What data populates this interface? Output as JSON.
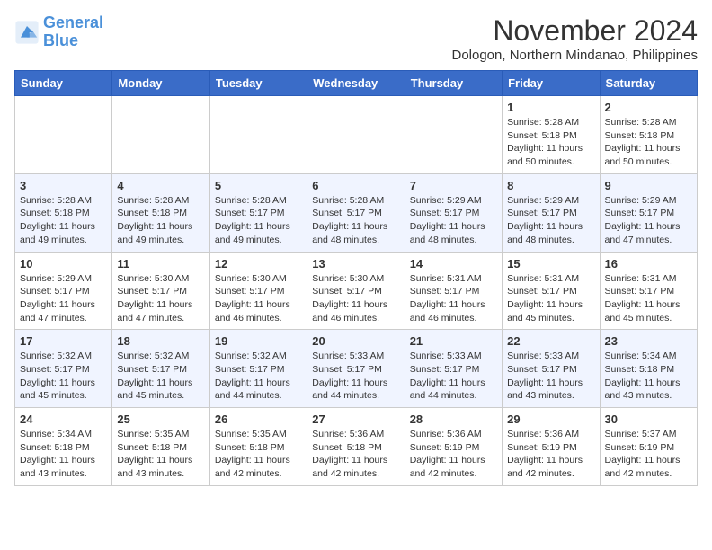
{
  "header": {
    "logo_line1": "General",
    "logo_line2": "Blue",
    "month_title": "November 2024",
    "location": "Dologon, Northern Mindanao, Philippines"
  },
  "weekdays": [
    "Sunday",
    "Monday",
    "Tuesday",
    "Wednesday",
    "Thursday",
    "Friday",
    "Saturday"
  ],
  "weeks": [
    [
      {
        "day": "",
        "info": ""
      },
      {
        "day": "",
        "info": ""
      },
      {
        "day": "",
        "info": ""
      },
      {
        "day": "",
        "info": ""
      },
      {
        "day": "",
        "info": ""
      },
      {
        "day": "1",
        "info": "Sunrise: 5:28 AM\nSunset: 5:18 PM\nDaylight: 11 hours and 50 minutes."
      },
      {
        "day": "2",
        "info": "Sunrise: 5:28 AM\nSunset: 5:18 PM\nDaylight: 11 hours and 50 minutes."
      }
    ],
    [
      {
        "day": "3",
        "info": "Sunrise: 5:28 AM\nSunset: 5:18 PM\nDaylight: 11 hours and 49 minutes."
      },
      {
        "day": "4",
        "info": "Sunrise: 5:28 AM\nSunset: 5:18 PM\nDaylight: 11 hours and 49 minutes."
      },
      {
        "day": "5",
        "info": "Sunrise: 5:28 AM\nSunset: 5:17 PM\nDaylight: 11 hours and 49 minutes."
      },
      {
        "day": "6",
        "info": "Sunrise: 5:28 AM\nSunset: 5:17 PM\nDaylight: 11 hours and 48 minutes."
      },
      {
        "day": "7",
        "info": "Sunrise: 5:29 AM\nSunset: 5:17 PM\nDaylight: 11 hours and 48 minutes."
      },
      {
        "day": "8",
        "info": "Sunrise: 5:29 AM\nSunset: 5:17 PM\nDaylight: 11 hours and 48 minutes."
      },
      {
        "day": "9",
        "info": "Sunrise: 5:29 AM\nSunset: 5:17 PM\nDaylight: 11 hours and 47 minutes."
      }
    ],
    [
      {
        "day": "10",
        "info": "Sunrise: 5:29 AM\nSunset: 5:17 PM\nDaylight: 11 hours and 47 minutes."
      },
      {
        "day": "11",
        "info": "Sunrise: 5:30 AM\nSunset: 5:17 PM\nDaylight: 11 hours and 47 minutes."
      },
      {
        "day": "12",
        "info": "Sunrise: 5:30 AM\nSunset: 5:17 PM\nDaylight: 11 hours and 46 minutes."
      },
      {
        "day": "13",
        "info": "Sunrise: 5:30 AM\nSunset: 5:17 PM\nDaylight: 11 hours and 46 minutes."
      },
      {
        "day": "14",
        "info": "Sunrise: 5:31 AM\nSunset: 5:17 PM\nDaylight: 11 hours and 46 minutes."
      },
      {
        "day": "15",
        "info": "Sunrise: 5:31 AM\nSunset: 5:17 PM\nDaylight: 11 hours and 45 minutes."
      },
      {
        "day": "16",
        "info": "Sunrise: 5:31 AM\nSunset: 5:17 PM\nDaylight: 11 hours and 45 minutes."
      }
    ],
    [
      {
        "day": "17",
        "info": "Sunrise: 5:32 AM\nSunset: 5:17 PM\nDaylight: 11 hours and 45 minutes."
      },
      {
        "day": "18",
        "info": "Sunrise: 5:32 AM\nSunset: 5:17 PM\nDaylight: 11 hours and 45 minutes."
      },
      {
        "day": "19",
        "info": "Sunrise: 5:32 AM\nSunset: 5:17 PM\nDaylight: 11 hours and 44 minutes."
      },
      {
        "day": "20",
        "info": "Sunrise: 5:33 AM\nSunset: 5:17 PM\nDaylight: 11 hours and 44 minutes."
      },
      {
        "day": "21",
        "info": "Sunrise: 5:33 AM\nSunset: 5:17 PM\nDaylight: 11 hours and 44 minutes."
      },
      {
        "day": "22",
        "info": "Sunrise: 5:33 AM\nSunset: 5:17 PM\nDaylight: 11 hours and 43 minutes."
      },
      {
        "day": "23",
        "info": "Sunrise: 5:34 AM\nSunset: 5:18 PM\nDaylight: 11 hours and 43 minutes."
      }
    ],
    [
      {
        "day": "24",
        "info": "Sunrise: 5:34 AM\nSunset: 5:18 PM\nDaylight: 11 hours and 43 minutes."
      },
      {
        "day": "25",
        "info": "Sunrise: 5:35 AM\nSunset: 5:18 PM\nDaylight: 11 hours and 43 minutes."
      },
      {
        "day": "26",
        "info": "Sunrise: 5:35 AM\nSunset: 5:18 PM\nDaylight: 11 hours and 42 minutes."
      },
      {
        "day": "27",
        "info": "Sunrise: 5:36 AM\nSunset: 5:18 PM\nDaylight: 11 hours and 42 minutes."
      },
      {
        "day": "28",
        "info": "Sunrise: 5:36 AM\nSunset: 5:19 PM\nDaylight: 11 hours and 42 minutes."
      },
      {
        "day": "29",
        "info": "Sunrise: 5:36 AM\nSunset: 5:19 PM\nDaylight: 11 hours and 42 minutes."
      },
      {
        "day": "30",
        "info": "Sunrise: 5:37 AM\nSunset: 5:19 PM\nDaylight: 11 hours and 42 minutes."
      }
    ]
  ]
}
